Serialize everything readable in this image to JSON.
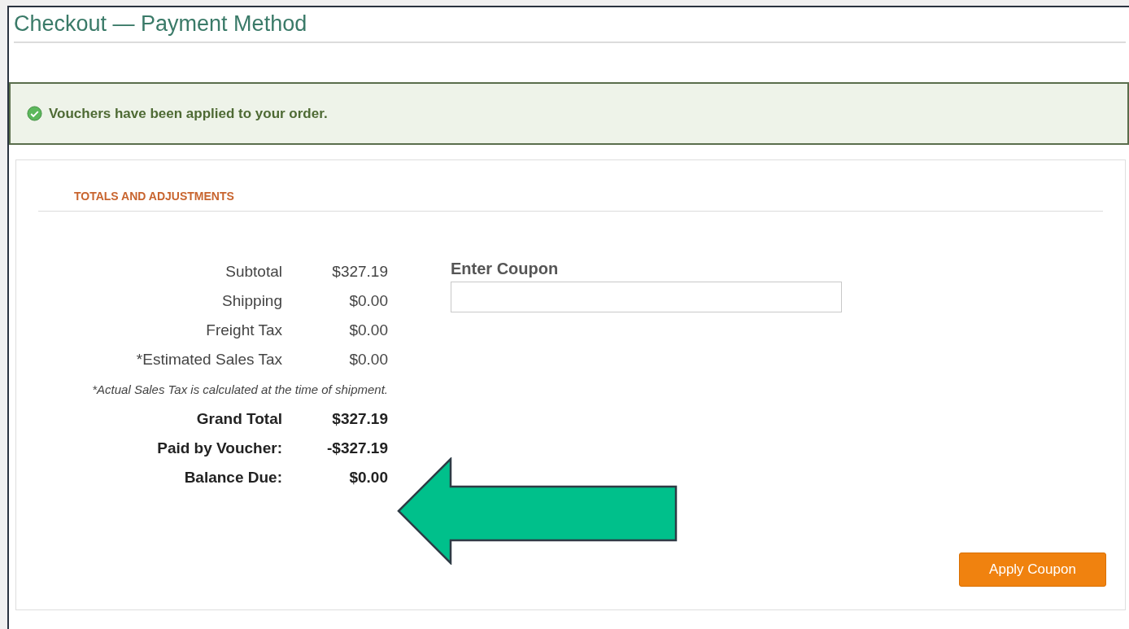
{
  "page": {
    "title": "Checkout — Payment Method"
  },
  "alert": {
    "kind": "success",
    "message": "Vouchers have been applied to your order."
  },
  "totals": {
    "heading": "TOTALS AND ADJUSTMENTS",
    "rows": [
      {
        "kind": "line",
        "label": "Subtotal",
        "value": "$327.19"
      },
      {
        "kind": "line",
        "label": "Shipping",
        "value": "$0.00"
      },
      {
        "kind": "line",
        "label": "Freight Tax",
        "value": "$0.00"
      },
      {
        "kind": "line",
        "label": "*Estimated Sales Tax",
        "value": "$0.00"
      },
      {
        "kind": "note",
        "text": "*Actual Sales Tax is calculated at the time of shipment."
      },
      {
        "kind": "total",
        "label": "Grand Total",
        "value": "$327.19"
      },
      {
        "kind": "total",
        "label": "Paid by Voucher:",
        "value": "-$327.19"
      },
      {
        "kind": "total",
        "label": "Balance Due:",
        "value": "$0.00"
      }
    ]
  },
  "coupon": {
    "label": "Enter Coupon",
    "button": "Apply Coupon"
  }
}
